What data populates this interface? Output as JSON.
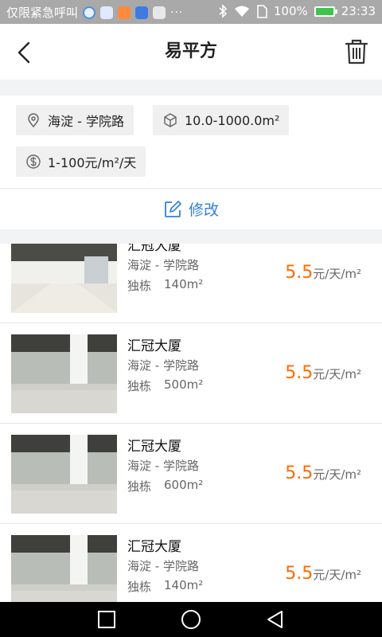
{
  "status_bar": {
    "carrier": "仅限紧急呼叫",
    "more": "···",
    "battery_text": "100%",
    "time": "23:33"
  },
  "header": {
    "title": "易平方",
    "back_icon": "chevron-left-icon",
    "delete_icon": "trash-icon"
  },
  "filters": {
    "location": "海淀 - 学院路",
    "area": "10.0-1000.0m²",
    "price": "1-100元/m²/天"
  },
  "edit_label": "修改",
  "colors": {
    "accent": "#2f7fdc",
    "price": "#ff6a00"
  },
  "listings": [
    {
      "name": "汇冠大厦",
      "address": "海淀 - 学院路",
      "type": "独栋",
      "area": "140m²",
      "price": "5.5",
      "unit": "元/天/m²"
    },
    {
      "name": "汇冠大厦",
      "address": "海淀 - 学院路",
      "type": "独栋",
      "area": "500m²",
      "price": "5.5",
      "unit": "元/天/m²"
    },
    {
      "name": "汇冠大厦",
      "address": "海淀 - 学院路",
      "type": "独栋",
      "area": "600m²",
      "price": "5.5",
      "unit": "元/天/m²"
    },
    {
      "name": "汇冠大厦",
      "address": "海淀 - 学院路",
      "type": "独栋",
      "area": "140m²",
      "price": "5.5",
      "unit": "元/天/m²"
    }
  ]
}
